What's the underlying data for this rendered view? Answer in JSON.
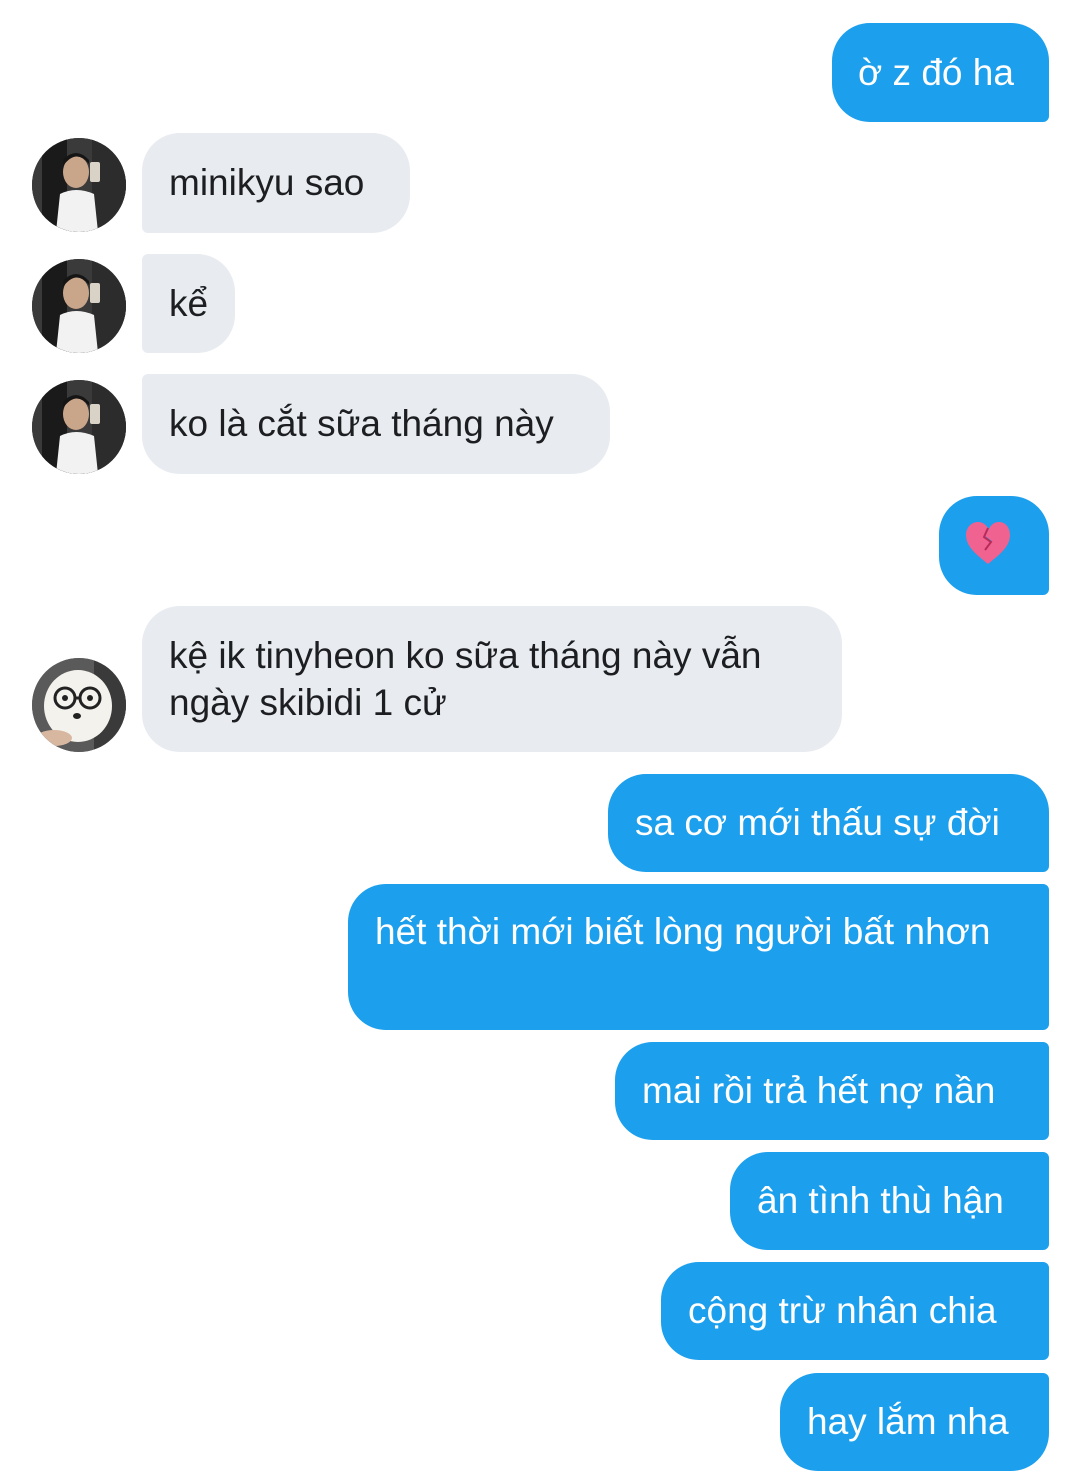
{
  "conversation": {
    "messages": [
      {
        "text": "ờ z đó ha"
      },
      {
        "text": "minikyu sao"
      },
      {
        "text": "kể"
      },
      {
        "text": "ko là cắt sữa tháng này"
      },
      {
        "text": "💔",
        "emoji_name": "broken-heart"
      },
      {
        "text": "kệ ik tinyheon ko sữa tháng này vẫn ngày skibidi 1 cử"
      },
      {
        "text": "sa cơ mới thấu sự đời"
      },
      {
        "text": "hết thời mới biết lòng người bất nhơn"
      },
      {
        "text": "mai rồi trả hết nợ nần"
      },
      {
        "text": "ân tình thù hận"
      },
      {
        "text": "cộng trừ nhân chia"
      },
      {
        "text": "hay lắm nha"
      }
    ]
  },
  "theme": {
    "outgoing_bubble": "#1c9fec",
    "incoming_bubble": "#e8ebef",
    "incoming_text": "#1c1e21",
    "outgoing_text": "#ffffff"
  }
}
